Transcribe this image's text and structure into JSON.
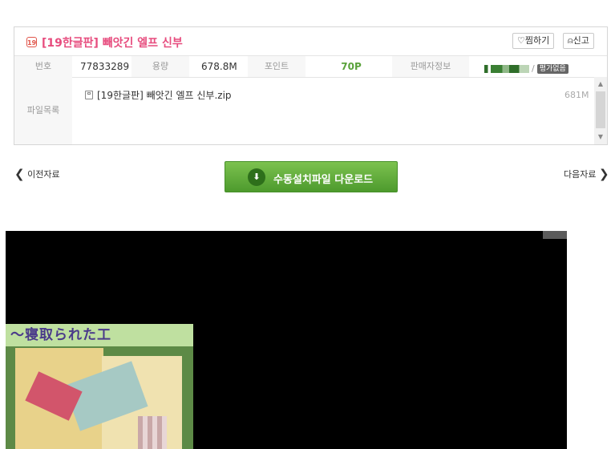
{
  "post": {
    "age_badge": "19",
    "title": "[19한글판] 빼앗긴 엘프 신부",
    "fav_label": "♡찜하기",
    "report_label": "⍝신고"
  },
  "info": {
    "number_label": "번호",
    "number_value": "77833289",
    "size_label": "용량",
    "size_value": "678.8M",
    "point_label": "포인트",
    "point_value": "70P",
    "seller_label": "판매자정보",
    "seller_rating": "평가없음"
  },
  "files": {
    "label": "파일목록",
    "items": [
      {
        "name": "[19한글판] 빼앗긴 엘프 신부.zip",
        "size": "681M"
      }
    ]
  },
  "nav": {
    "prev_label": "이전자료",
    "next_label": "다음자료",
    "download_label": "수동설치파일 다운로드"
  },
  "preview": {
    "banner_text": "～寝取られた工"
  },
  "colors": {
    "title": "#e74c7e",
    "points": "#5aa23b",
    "download_button": "#5ea834"
  },
  "icons": {
    "age": "age-19-icon",
    "fav": "heart-icon",
    "report": "siren-icon",
    "file": "save-disk-icon",
    "download": "download-arrow-icon",
    "prev": "chevron-left-icon",
    "next": "chevron-right-icon"
  }
}
